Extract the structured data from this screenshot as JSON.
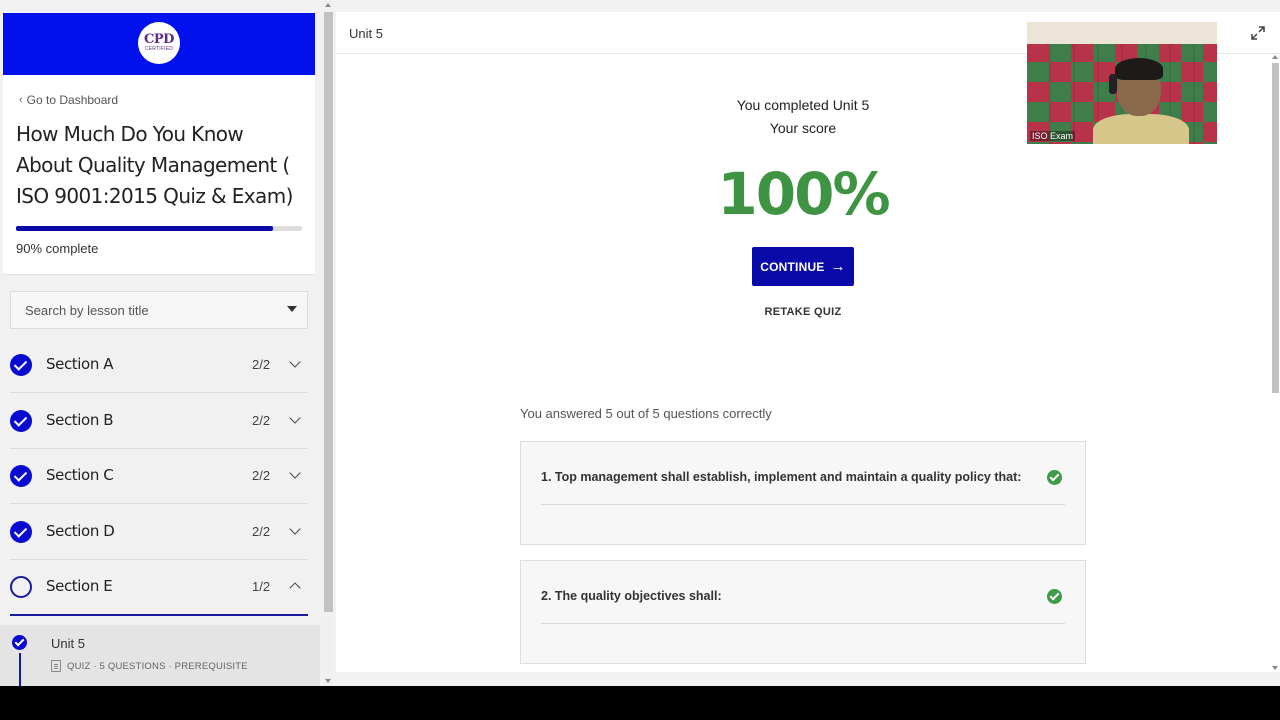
{
  "sidebar": {
    "logo": {
      "main": "CPD",
      "sub": "CERTIFIED"
    },
    "back_link": "Go to Dashboard",
    "course_title": "How Much Do You Know About Quality Management ( ISO 9001:2015 Quiz & Exam)",
    "progress": {
      "fraction": 0.9,
      "label": "90% complete"
    },
    "search_placeholder": "Search by lesson title",
    "sections": [
      {
        "name": "Section A",
        "count": "2/2",
        "status": "complete",
        "expanded": false
      },
      {
        "name": "Section B",
        "count": "2/2",
        "status": "complete",
        "expanded": false
      },
      {
        "name": "Section C",
        "count": "2/2",
        "status": "complete",
        "expanded": false
      },
      {
        "name": "Section D",
        "count": "2/2",
        "status": "complete",
        "expanded": false
      },
      {
        "name": "Section E",
        "count": "1/2",
        "status": "in-progress",
        "expanded": true
      }
    ],
    "lesson": {
      "name": "Unit 5",
      "meta": "QUIZ · 5 QUESTIONS · PREREQUISITE",
      "status": "complete"
    }
  },
  "main": {
    "unit_title": "Unit 5",
    "webcam_label": "ISO Exam",
    "result": {
      "completed_text": "You completed Unit 5",
      "score_label": "Your score",
      "score": "100%",
      "continue_label": "CONTINUE",
      "retake_label": "RETAKE QUIZ"
    },
    "answered_text": "You answered 5 out of 5 questions correctly",
    "questions": [
      {
        "text": "1. Top management shall establish, implement and maintain a quality policy that:",
        "correct": true
      },
      {
        "text": "2. The quality objectives shall:",
        "correct": true
      }
    ]
  },
  "colors": {
    "brand_blue": "#0011ee",
    "primary_button": "#0a0aa8",
    "score_green": "#3f9443",
    "check_green": "#3f9a4a"
  },
  "icons": [
    "chevron-left-icon",
    "caret-down-icon",
    "check-circle-icon",
    "empty-circle-icon",
    "chevron-down-icon",
    "chevron-up-icon",
    "quiz-icon",
    "expand-icon",
    "arrow-right-icon"
  ]
}
